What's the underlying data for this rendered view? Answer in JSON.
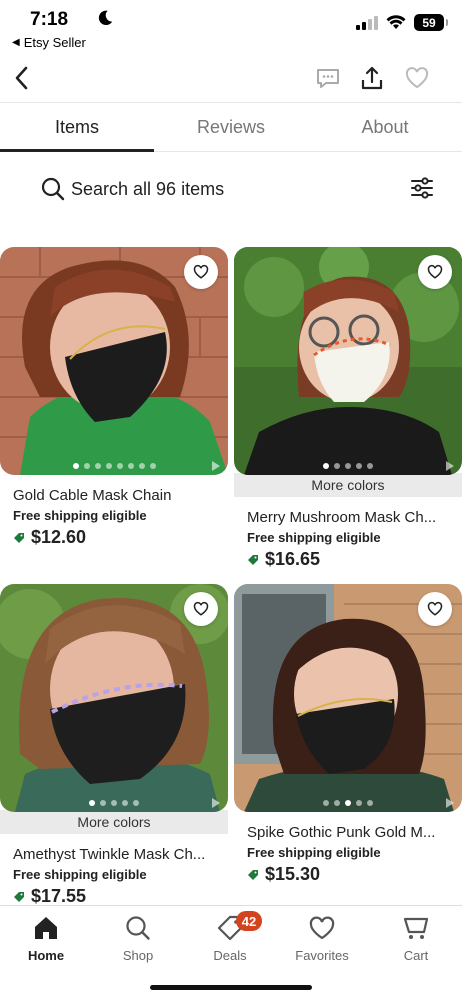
{
  "status_bar": {
    "time": "7:18",
    "back_app": "Etsy Seller",
    "battery": "59"
  },
  "tabs": [
    {
      "label": "Items",
      "active": true
    },
    {
      "label": "Reviews",
      "active": false
    },
    {
      "label": "About",
      "active": false
    }
  ],
  "search": {
    "text": "Search all 96 items"
  },
  "products": [
    {
      "title": "Gold Cable Mask Chain",
      "shipping": "Free shipping eligible",
      "price": "$12.60",
      "more_colors": ""
    },
    {
      "title": "Merry Mushroom Mask Ch...",
      "shipping": "Free shipping eligible",
      "price": "$16.65",
      "more_colors": "More colors"
    },
    {
      "title": "Amethyst Twinkle Mask Ch...",
      "shipping": "Free shipping eligible",
      "price": "$17.55",
      "more_colors": "More colors"
    },
    {
      "title": "Spike Gothic Punk Gold M...",
      "shipping": "Free shipping eligible",
      "price": "$15.30",
      "more_colors": ""
    }
  ],
  "bottom_nav": {
    "home": "Home",
    "shop": "Shop",
    "deals": "Deals",
    "deals_badge": "42",
    "favorites": "Favorites",
    "cart": "Cart"
  },
  "colors": {
    "accent_green": "#1e7a3c",
    "badge_orange": "#d1441d"
  }
}
